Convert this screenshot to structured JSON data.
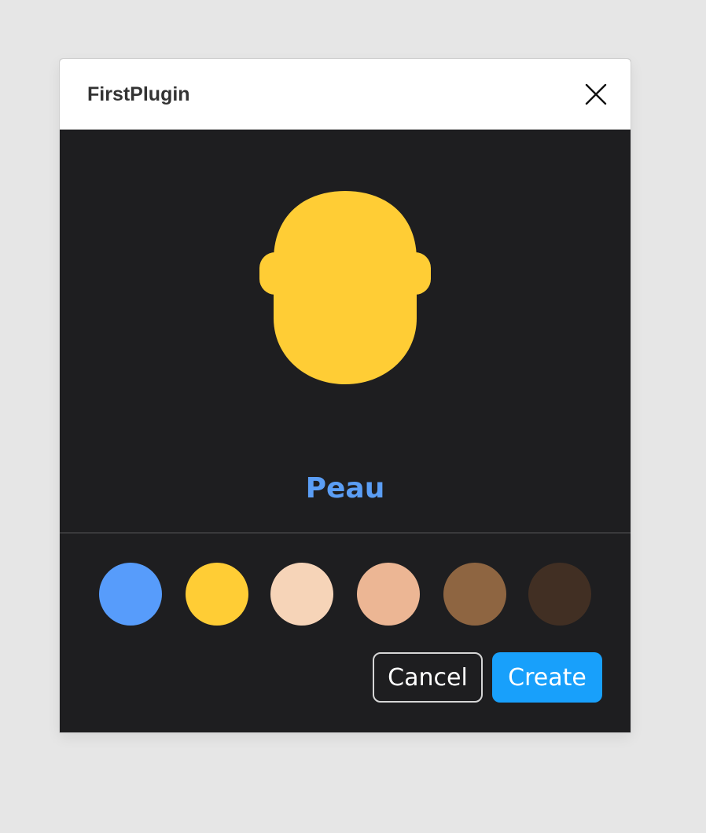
{
  "window": {
    "title": "FirstPlugin"
  },
  "preview": {
    "label": "Peau",
    "label_color": "#5b9ef5",
    "avatar_color": "#ffcd35"
  },
  "swatches": [
    {
      "color": "#579cfb"
    },
    {
      "color": "#ffcd35"
    },
    {
      "color": "#f6d4b8"
    },
    {
      "color": "#ecb694"
    },
    {
      "color": "#8e6541"
    },
    {
      "color": "#412f23"
    }
  ],
  "actions": {
    "cancel_label": "Cancel",
    "create_label": "Create",
    "create_color": "#18a0fb"
  }
}
